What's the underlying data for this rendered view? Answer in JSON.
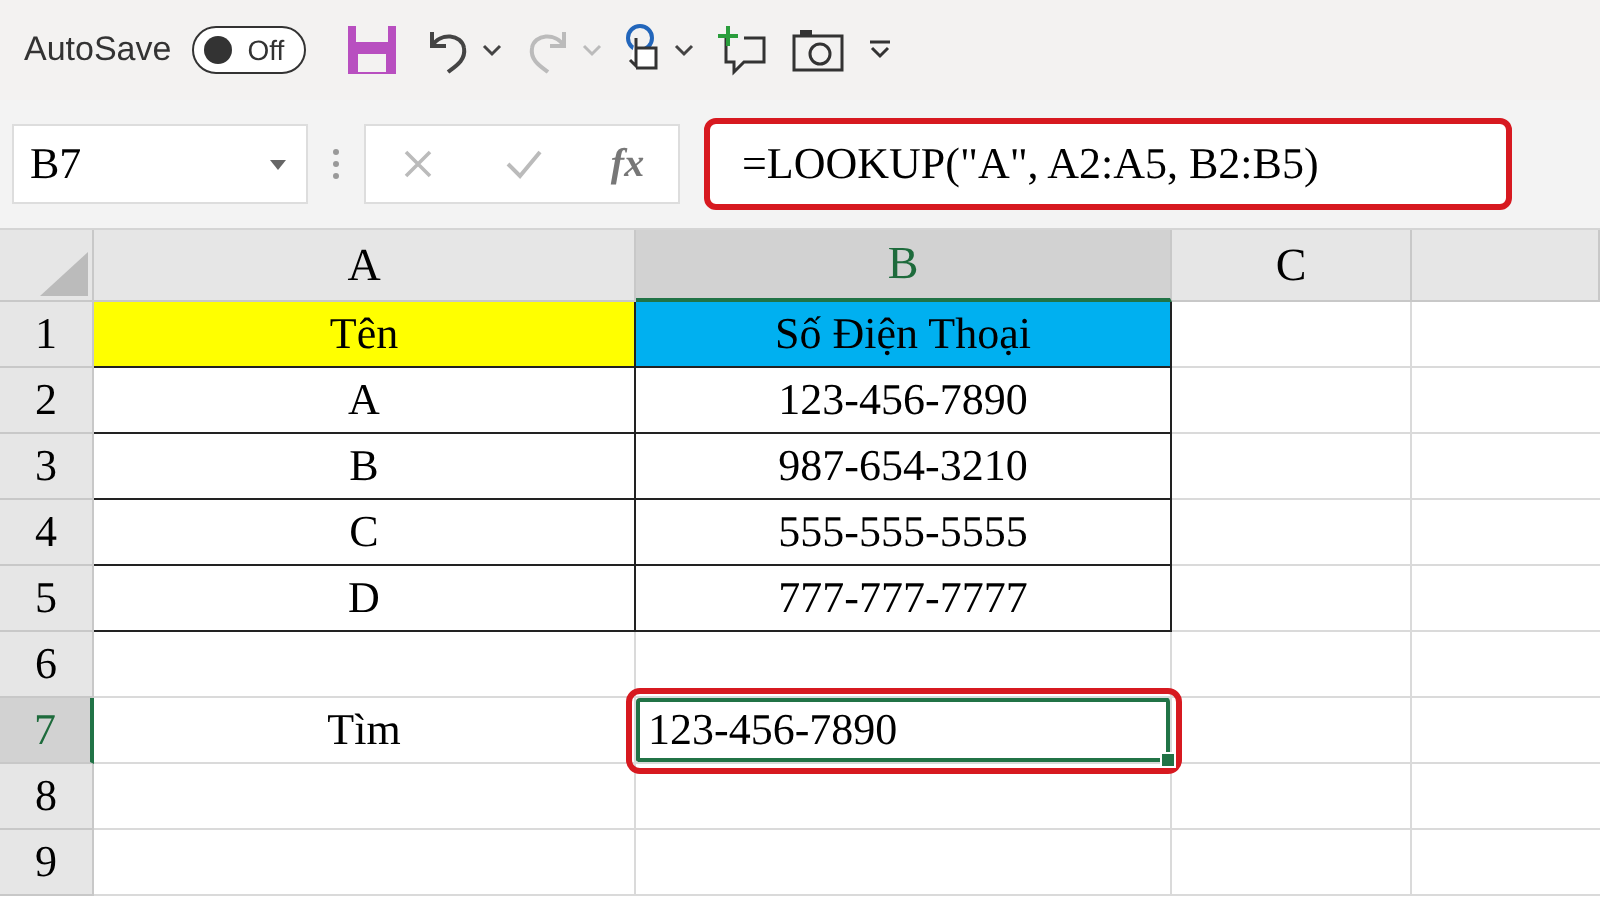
{
  "quick_access": {
    "autosave_label": "AutoSave",
    "autosave_on": false,
    "autosave_state": "Off"
  },
  "formula_bar": {
    "name_box": "B7",
    "fx": "fx",
    "formula": "=LOOKUP(\"A\", A2:A5, B2:B5)",
    "highlighted": true
  },
  "columns": [
    {
      "label": "A",
      "selected": false
    },
    {
      "label": "B",
      "selected": true
    },
    {
      "label": "C",
      "selected": false
    }
  ],
  "rows": [
    {
      "label": "1",
      "selected": false,
      "cells": [
        {
          "text": "Tên",
          "color": "#ffff00",
          "bordered": true
        },
        {
          "text": "Số Điện Thoại",
          "color": "#00b0f0",
          "bordered": true
        }
      ]
    },
    {
      "label": "2",
      "selected": false,
      "cells": [
        {
          "text": "A",
          "bordered": true
        },
        {
          "text": "123-456-7890",
          "bordered": true
        }
      ]
    },
    {
      "label": "3",
      "selected": false,
      "cells": [
        {
          "text": "B",
          "bordered": true
        },
        {
          "text": "987-654-3210",
          "bordered": true
        }
      ]
    },
    {
      "label": "4",
      "selected": false,
      "cells": [
        {
          "text": "C",
          "bordered": true
        },
        {
          "text": "555-555-5555",
          "bordered": true
        }
      ]
    },
    {
      "label": "5",
      "selected": false,
      "cells": [
        {
          "text": "D",
          "bordered": true
        },
        {
          "text": "777-777-7777",
          "bordered": true
        }
      ]
    },
    {
      "label": "6",
      "selected": false,
      "cells": []
    },
    {
      "label": "7",
      "selected": true,
      "cells": [
        {
          "text": "Tìm",
          "bordered": false
        },
        {
          "text": "123-456-7890",
          "bordered": false,
          "kind": "result",
          "selected": true,
          "highlighted": true
        }
      ]
    },
    {
      "label": "8",
      "selected": false,
      "cells": []
    },
    {
      "label": "9",
      "selected": false,
      "cells": []
    }
  ]
}
